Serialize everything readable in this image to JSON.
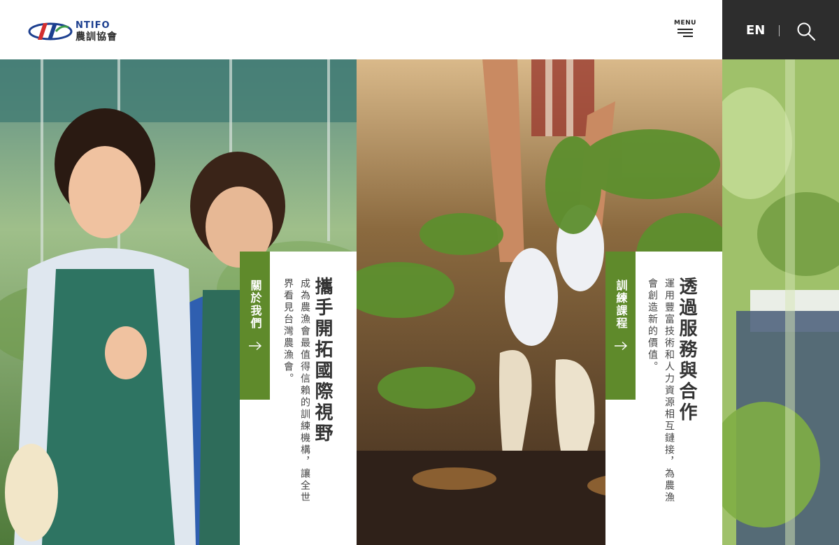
{
  "header": {
    "logo_en": "NTIFO",
    "logo_zh": "農訓協會",
    "menu_label": "MENU"
  },
  "utility": {
    "language_label": "EN"
  },
  "cards": {
    "about": {
      "tag": "關於我們",
      "title": "攜手開拓國際視野",
      "description": "成為農漁會最值得信賴的訓練機構，讓全世界看見台灣農漁會。"
    },
    "training": {
      "tag": "訓練課程",
      "title": "透過服務與合作",
      "description": "運用豐富技術和人力資源相互鏈接，為農漁會創造新的價值。"
    }
  },
  "icons": {
    "logo": "ntifo-logo-icon",
    "menu": "hamburger-menu-icon",
    "search": "search-icon",
    "arrow": "arrow-right-icon"
  },
  "colors": {
    "accent_green": "#5f8a2b",
    "util_bar": "#2d2d2d",
    "logo_blue": "#1c3f8f",
    "logo_red": "#d32f2f"
  }
}
